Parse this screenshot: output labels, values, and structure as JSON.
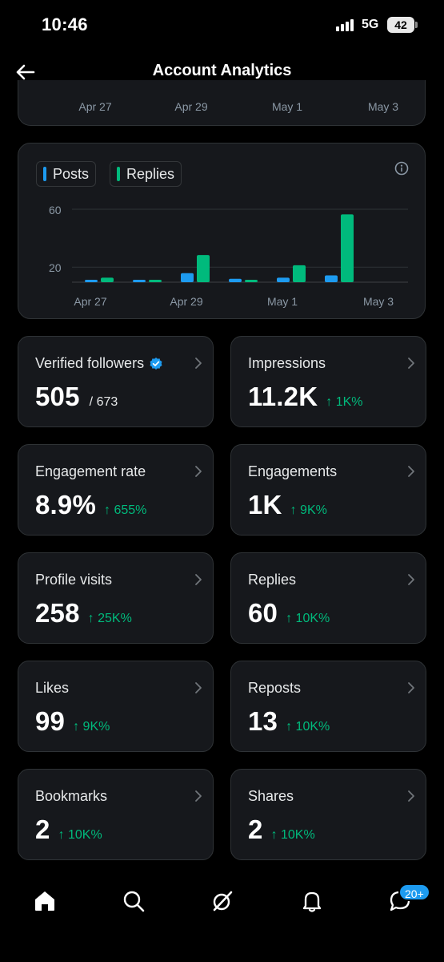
{
  "status": {
    "time": "10:46",
    "network": "5G",
    "battery": "42"
  },
  "header": {
    "title": "Account Analytics"
  },
  "top_card": {
    "x_labels": [
      "Apr 27",
      "Apr 29",
      "May 1",
      "May 3"
    ]
  },
  "chart_data": {
    "type": "bar",
    "legend": [
      "Posts",
      "Replies"
    ],
    "x_tick_labels": [
      "Apr 27",
      "Apr 29",
      "May 1",
      "May 3"
    ],
    "y_tick_labels": [
      "60",
      "20"
    ],
    "ylim": [
      0,
      60
    ],
    "series": [
      {
        "name": "Posts",
        "color": "#1d9bf0",
        "values": [
          2,
          2,
          8,
          3,
          4,
          6
        ]
      },
      {
        "name": "Replies",
        "color": "#00ba7c",
        "values": [
          4,
          1,
          24,
          1,
          15,
          60
        ]
      }
    ]
  },
  "metrics": [
    {
      "label": "Verified followers",
      "value": "505",
      "sub": "/ 673",
      "verified": true
    },
    {
      "label": "Impressions",
      "value": "11.2K",
      "delta": "↑ 1K%"
    },
    {
      "label": "Engagement rate",
      "value": "8.9%",
      "delta": "↑ 655%"
    },
    {
      "label": "Engagements",
      "value": "1K",
      "delta": "↑ 9K%"
    },
    {
      "label": "Profile visits",
      "value": "258",
      "delta": "↑ 25K%"
    },
    {
      "label": "Replies",
      "value": "60",
      "delta": "↑ 10K%"
    },
    {
      "label": "Likes",
      "value": "99",
      "delta": "↑ 9K%"
    },
    {
      "label": "Reposts",
      "value": "13",
      "delta": "↑ 10K%"
    },
    {
      "label": "Bookmarks",
      "value": "2",
      "delta": "↑ 10K%"
    },
    {
      "label": "Shares",
      "value": "2",
      "delta": "↑ 10K%"
    }
  ],
  "nav": {
    "items": [
      "home-icon",
      "search-icon",
      "grok-icon",
      "bell-icon",
      "messages-icon"
    ],
    "badge": "20+"
  },
  "colors": {
    "accent": "#1d9bf0",
    "positive": "#00ba7c",
    "card": "#16181c",
    "border": "#2f3336"
  }
}
